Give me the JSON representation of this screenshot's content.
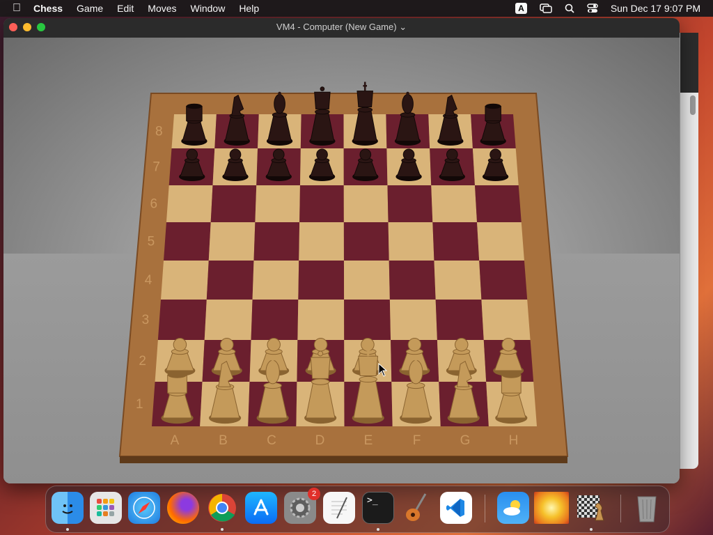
{
  "menubar": {
    "apple_icon": "apple-logo",
    "app_name": "Chess",
    "menus": [
      "Game",
      "Edit",
      "Moves",
      "Window",
      "Help"
    ],
    "input_source": "A",
    "datetime": "Sun Dec 17  9:07 PM"
  },
  "window": {
    "title": "VM4 - Computer   (New Game)",
    "chevron": "⌄"
  },
  "board": {
    "ranks": [
      "8",
      "7",
      "6",
      "5",
      "4",
      "3",
      "2",
      "1"
    ],
    "files": [
      "A",
      "B",
      "C",
      "D",
      "E",
      "F",
      "G",
      "H"
    ],
    "black_back_rank": [
      "rook",
      "knight",
      "bishop",
      "queen",
      "king",
      "bishop",
      "knight",
      "rook"
    ],
    "white_back_rank": [
      "rook",
      "knight",
      "bishop",
      "queen",
      "king",
      "bishop",
      "knight",
      "rook"
    ]
  },
  "dock": {
    "apps": [
      {
        "name": "Finder",
        "icon": "finder-icon",
        "running": true
      },
      {
        "name": "Launchpad",
        "icon": "launchpad-icon",
        "running": false
      },
      {
        "name": "Safari",
        "icon": "safari-icon",
        "running": false
      },
      {
        "name": "Firefox",
        "icon": "firefox-icon",
        "running": false
      },
      {
        "name": "Chrome",
        "icon": "chrome-icon",
        "running": true
      },
      {
        "name": "App Store",
        "icon": "appstore-icon",
        "running": false
      },
      {
        "name": "System Settings",
        "icon": "settings-icon",
        "running": false,
        "badge": "2"
      },
      {
        "name": "TextEdit",
        "icon": "textedit-icon",
        "running": false
      },
      {
        "name": "Terminal",
        "icon": "terminal-icon",
        "running": true
      },
      {
        "name": "GarageBand",
        "icon": "guitar-icon",
        "running": false
      },
      {
        "name": "VS Code",
        "icon": "vscode-icon",
        "running": false
      },
      {
        "name": "Weather",
        "icon": "weather-icon",
        "running": false
      },
      {
        "name": "Preview",
        "icon": "image-icon",
        "running": false
      },
      {
        "name": "Chess",
        "icon": "chess-icon",
        "running": true
      },
      {
        "name": "Trash",
        "icon": "trash-icon",
        "running": false
      }
    ],
    "settings_badge": "2",
    "terminal_glyph": ">_"
  },
  "colors": {
    "light_square": "#d9b479",
    "dark_square": "#6b1f2e",
    "frame": "#a8713d",
    "black_piece": "#2a1513",
    "white_piece": "#c49a5a"
  }
}
